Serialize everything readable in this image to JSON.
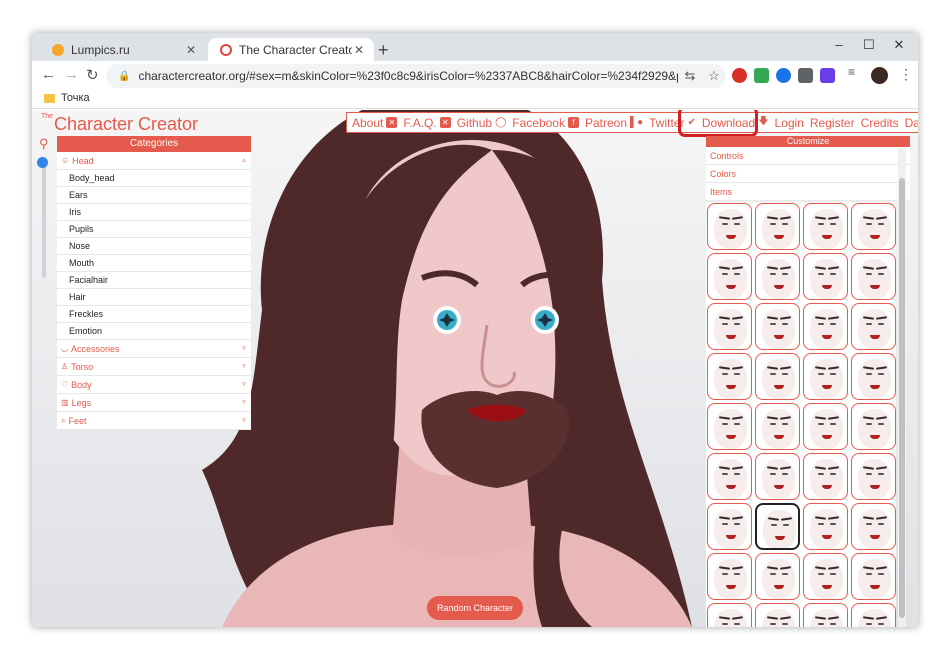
{
  "browser": {
    "tabs": [
      {
        "title": "Lumpics.ru",
        "close": "✕"
      },
      {
        "title": "The Character Creator - Build visu",
        "close": "✕"
      }
    ],
    "new_tab": "+",
    "window_controls": [
      "–",
      "☐",
      "✕"
    ],
    "nav": {
      "back": "←",
      "forward": "→",
      "reload": "↻"
    },
    "url": "charactercreator.org/#sex=m&skinColor=%23f0c8c9&irisColor=%2337ABC8&hairColor=%234f2929&pupils=star&ears=un...",
    "bookmark": "Точка"
  },
  "site": {
    "logo_the": "The",
    "logo": "Character Creator",
    "nav": [
      {
        "label": "About",
        "icon": "✕"
      },
      {
        "label": "F.A.Q.",
        "icon": "✕"
      },
      {
        "label": "Github",
        "icon": "◯"
      },
      {
        "label": "Facebook",
        "icon": "f"
      },
      {
        "label": "Patreon",
        "icon": "▌●"
      },
      {
        "label": "Twitter",
        "icon": "✔"
      },
      {
        "label": "Download",
        "icon": "🡇"
      },
      {
        "label": "Login"
      },
      {
        "label": "Register"
      },
      {
        "label": "Credits"
      },
      {
        "label": "Dark"
      }
    ],
    "categories": {
      "header": "Categories",
      "head": {
        "label": "Head",
        "caret": "▵"
      },
      "head_items": [
        "Body_head",
        "Ears",
        "Iris",
        "Pupils",
        "Nose",
        "Mouth",
        "Facialhair",
        "Hair",
        "Freckles",
        "Emotion"
      ],
      "sections": [
        {
          "label": "Accessories",
          "caret": "▿"
        },
        {
          "label": "Torso",
          "caret": "▿"
        },
        {
          "label": "Body",
          "caret": "▿"
        },
        {
          "label": "Legs",
          "caret": "▿"
        },
        {
          "label": "Feet",
          "caret": "▿"
        }
      ]
    },
    "customize": {
      "header": "Customize",
      "rows": [
        {
          "label": "Controls",
          "caret": "▿"
        },
        {
          "label": "Colors",
          "caret": "▵"
        },
        {
          "label": "Items",
          "caret": "▵"
        }
      ],
      "selected_item_index": 25
    },
    "random_button": "Random Character",
    "colors": {
      "accent": "#e45a4c",
      "skin": "#f0c8c9",
      "iris": "#37ABC8",
      "hair": "#4f2929",
      "highlight": "#d41f1f"
    }
  }
}
